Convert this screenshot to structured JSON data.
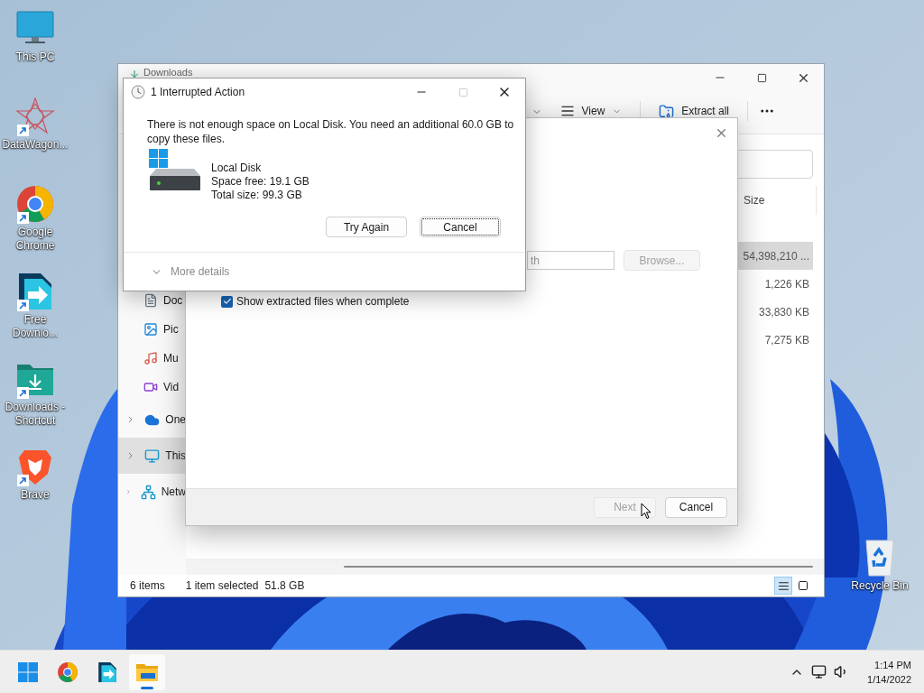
{
  "desktop_icons": [
    {
      "label": "This PC",
      "kind": "pc",
      "shortcut": false
    },
    {
      "label": "DataWagon...",
      "kind": "star",
      "shortcut": true
    },
    {
      "label": "Google Chrome",
      "kind": "chrome",
      "shortcut": true
    },
    {
      "label": "Free Downlo...",
      "kind": "fdm",
      "shortcut": true
    },
    {
      "label": "Downloads - Shortcut",
      "kind": "folder",
      "shortcut": true
    },
    {
      "label": "Brave",
      "kind": "brave",
      "shortcut": true
    }
  ],
  "recycle_bin": {
    "label": "Recycle Bin"
  },
  "explorer": {
    "title": "Downloads",
    "toolbar": [
      {
        "label": "View",
        "kind": "view"
      },
      {
        "label": "Extract all",
        "kind": "extract"
      }
    ],
    "nav": [
      {
        "label": "Doc",
        "kind": "doc",
        "expandable": false,
        "selected": false
      },
      {
        "label": "Pic",
        "kind": "pic",
        "expandable": false,
        "selected": false
      },
      {
        "label": "Mu",
        "kind": "music",
        "expandable": false,
        "selected": false
      },
      {
        "label": "Vid",
        "kind": "video",
        "expandable": false,
        "selected": false
      },
      {
        "label": "One",
        "kind": "cloud",
        "expandable": true,
        "selected": false
      },
      {
        "label": "This",
        "kind": "pc",
        "expandable": true,
        "selected": true
      },
      {
        "label": "Netw",
        "kind": "network",
        "expandable": true,
        "selected": false
      }
    ],
    "columns": [
      "Size"
    ],
    "rows": [
      {
        "size": "54,398,210 ...",
        "selected": true
      },
      {
        "size": "1,226 KB",
        "selected": false
      },
      {
        "size": "33,830 KB",
        "selected": false
      },
      {
        "size": "7,275 KB",
        "selected": false
      }
    ],
    "status": {
      "count": "6 items",
      "selection": "1 item selected",
      "selection_size": "51.8 GB"
    },
    "view_buttons": [
      {
        "kind": "details",
        "selected": true
      },
      {
        "kind": "tiles",
        "selected": false
      }
    ]
  },
  "extract_dialog": {
    "path_value": "th",
    "browse": {
      "label": "Browse...",
      "disabled": true
    },
    "show_files": {
      "label": "Show extracted files when complete",
      "checked": true
    },
    "buttons": [
      {
        "label": "Next",
        "disabled": true
      },
      {
        "label": "Cancel",
        "disabled": false
      }
    ]
  },
  "interrupted_dialog": {
    "title": "1 Interrupted Action",
    "message": "There is not enough space on Local Disk. You need an additional 60.0 GB to copy these files.",
    "drive": {
      "name": "Local Disk",
      "free": "Space free: 19.1 GB",
      "total": "Total size: 99.3 GB"
    },
    "buttons": [
      {
        "label": "Try Again",
        "focused": false
      },
      {
        "label": "Cancel",
        "focused": true
      }
    ],
    "more_details": "More details"
  },
  "taskbar": {
    "apps": [
      {
        "kind": "start",
        "active": false
      },
      {
        "kind": "chrome",
        "active": false
      },
      {
        "kind": "fdm",
        "active": false
      },
      {
        "kind": "explorer",
        "active": true
      }
    ],
    "time": "1:14 PM",
    "date": "1/14/2022"
  }
}
